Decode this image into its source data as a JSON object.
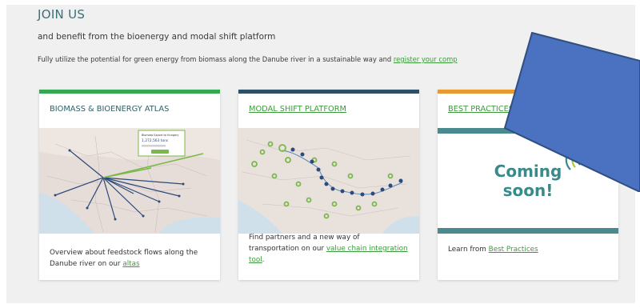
{
  "header": {
    "title": "JOIN US",
    "subtitle": "and benefit from the bioenergy and modal shift platform",
    "description": "Fully utilize the potential for green energy from biomass along the Danube river in a sustainable way and ",
    "description_link": "register your comp"
  },
  "cards": [
    {
      "title": "BIOMASS & BIOENERGY ATLAS",
      "text": "Overview about feedstock flows along the Danube river on our ",
      "link": "altas",
      "popup_title": "Biomass Export to Hungary",
      "popup_value": "1,272,563 tons",
      "bar_color": "#35a852"
    },
    {
      "title": "MODAL SHIFT PLATFORM",
      "text": "Find partners and a new way of transportation on our ",
      "link": "value chain integration tool",
      "text_end": ".",
      "bar_color": "#2f4f66"
    },
    {
      "title": "BEST PRACTICES",
      "text": "Learn from ",
      "link": "Best Practices",
      "coming_line1": "Coming",
      "coming_line2": "soon!",
      "bar_color": "#e89a2e"
    }
  ],
  "overlay": {
    "color": "#4a72c0",
    "border": "#2f4f80"
  }
}
